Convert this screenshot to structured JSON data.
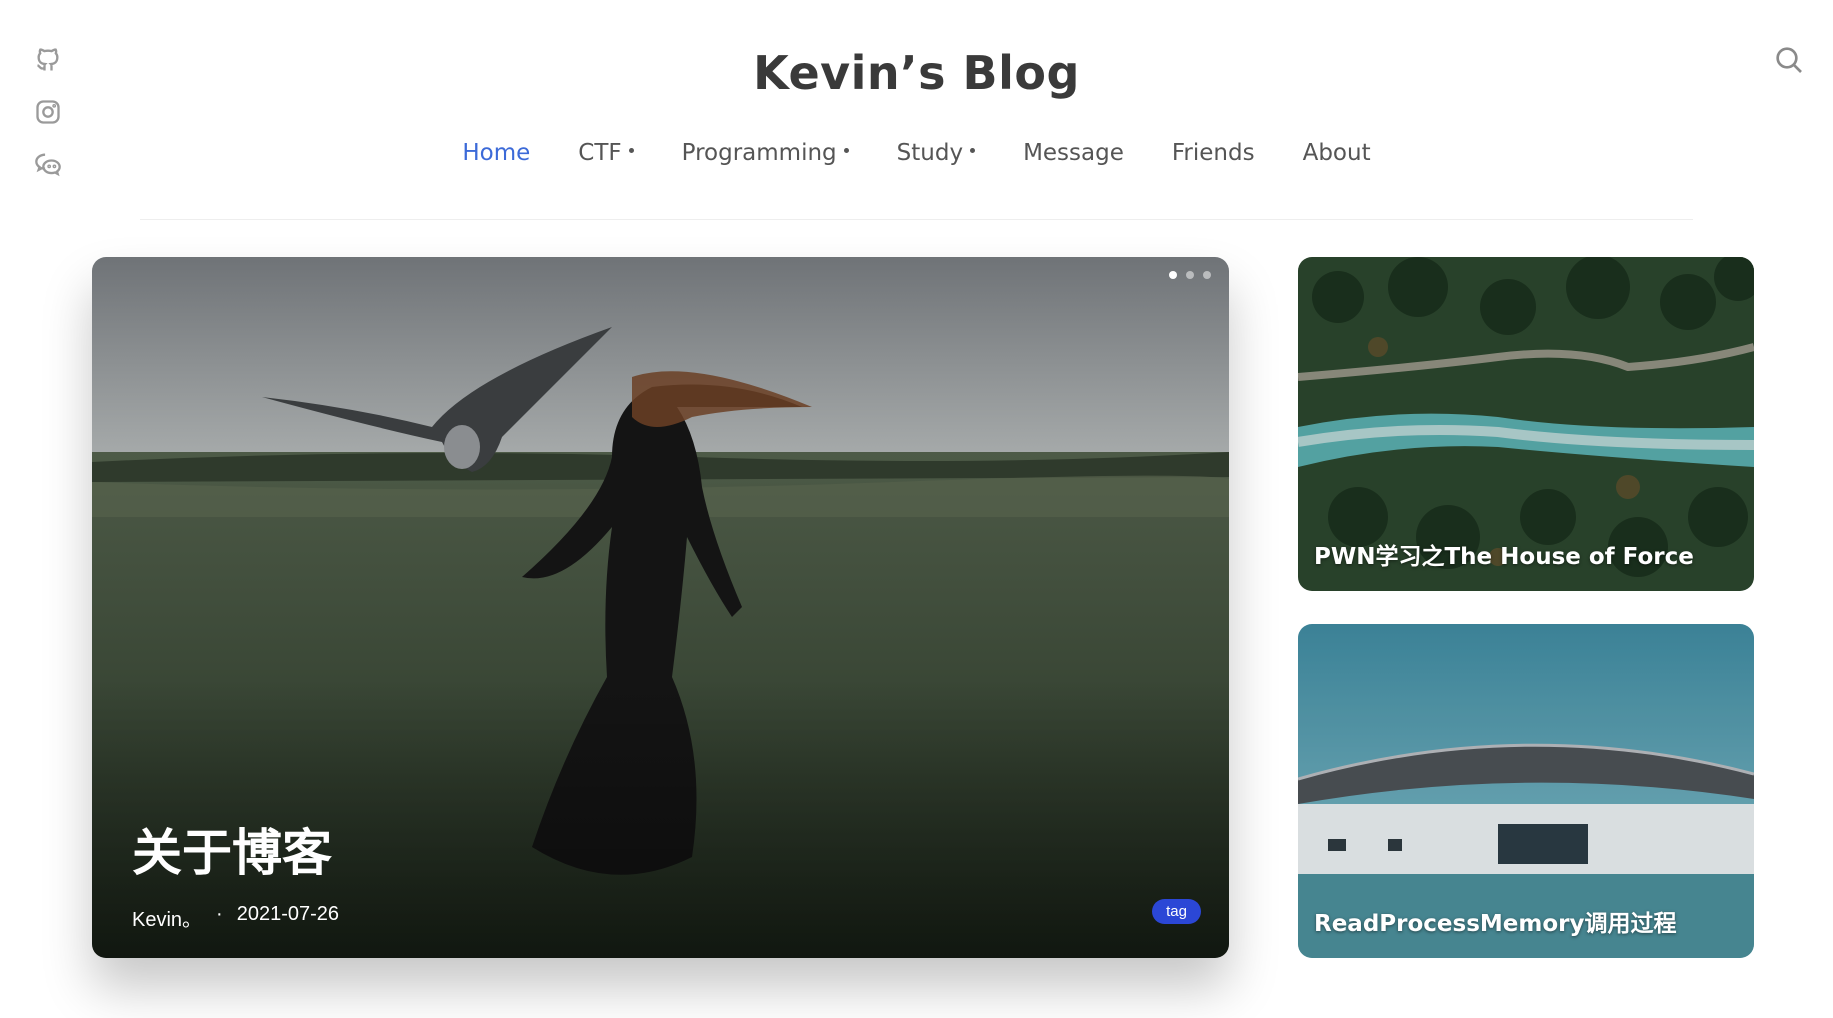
{
  "header": {
    "title": "Kevin’s Blog"
  },
  "social": [
    "github-icon",
    "instagram-icon",
    "wechat-icon"
  ],
  "nav": [
    {
      "label": "Home",
      "active": true,
      "dropdown": false
    },
    {
      "label": "CTF",
      "active": false,
      "dropdown": true
    },
    {
      "label": "Programming",
      "active": false,
      "dropdown": true
    },
    {
      "label": "Study",
      "active": false,
      "dropdown": true
    },
    {
      "label": "Message",
      "active": false,
      "dropdown": false
    },
    {
      "label": "Friends",
      "active": false,
      "dropdown": false
    },
    {
      "label": "About",
      "active": false,
      "dropdown": false
    }
  ],
  "hero": {
    "title": "关于博客",
    "author": "Kevin。",
    "separator": "·",
    "date": "2021-07-26",
    "tag": "tag",
    "slide_count": 3,
    "active_slide": 1
  },
  "cards": [
    {
      "title": "PWN学习之The House of Force"
    },
    {
      "title": "ReadProcessMemory调用过程"
    }
  ],
  "colors": {
    "accent": "#3c6ad8",
    "tag_bg": "#2b47d6"
  }
}
